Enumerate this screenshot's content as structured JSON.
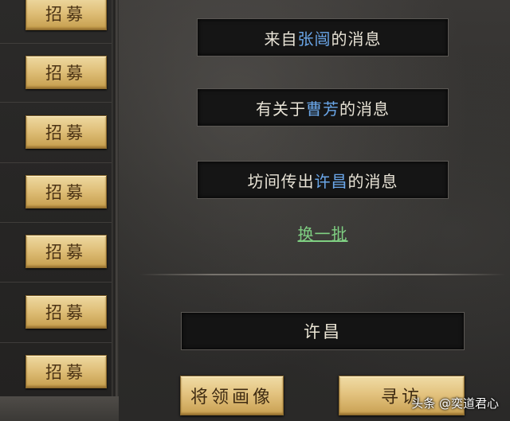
{
  "recruit_list": {
    "buttons": [
      "招募",
      "招募",
      "招募",
      "招募",
      "招募",
      "招募",
      "招募"
    ]
  },
  "messages": [
    {
      "prefix": "来自",
      "highlight": "张闿",
      "suffix": "的消息"
    },
    {
      "prefix": "有关于",
      "highlight": "曹芳",
      "suffix": "的消息"
    },
    {
      "prefix": "坊间传出",
      "highlight": "许昌",
      "suffix": "的消息"
    }
  ],
  "refresh_label": "换一批",
  "city_name": "许昌",
  "actions": {
    "portrait_label": "将领画像",
    "visit_label": "寻访"
  },
  "watermark": "头条 @奕道君心",
  "colors": {
    "highlight": "#6aa6e8",
    "link": "#7fcf82",
    "gold_button": "#e3c37f"
  }
}
